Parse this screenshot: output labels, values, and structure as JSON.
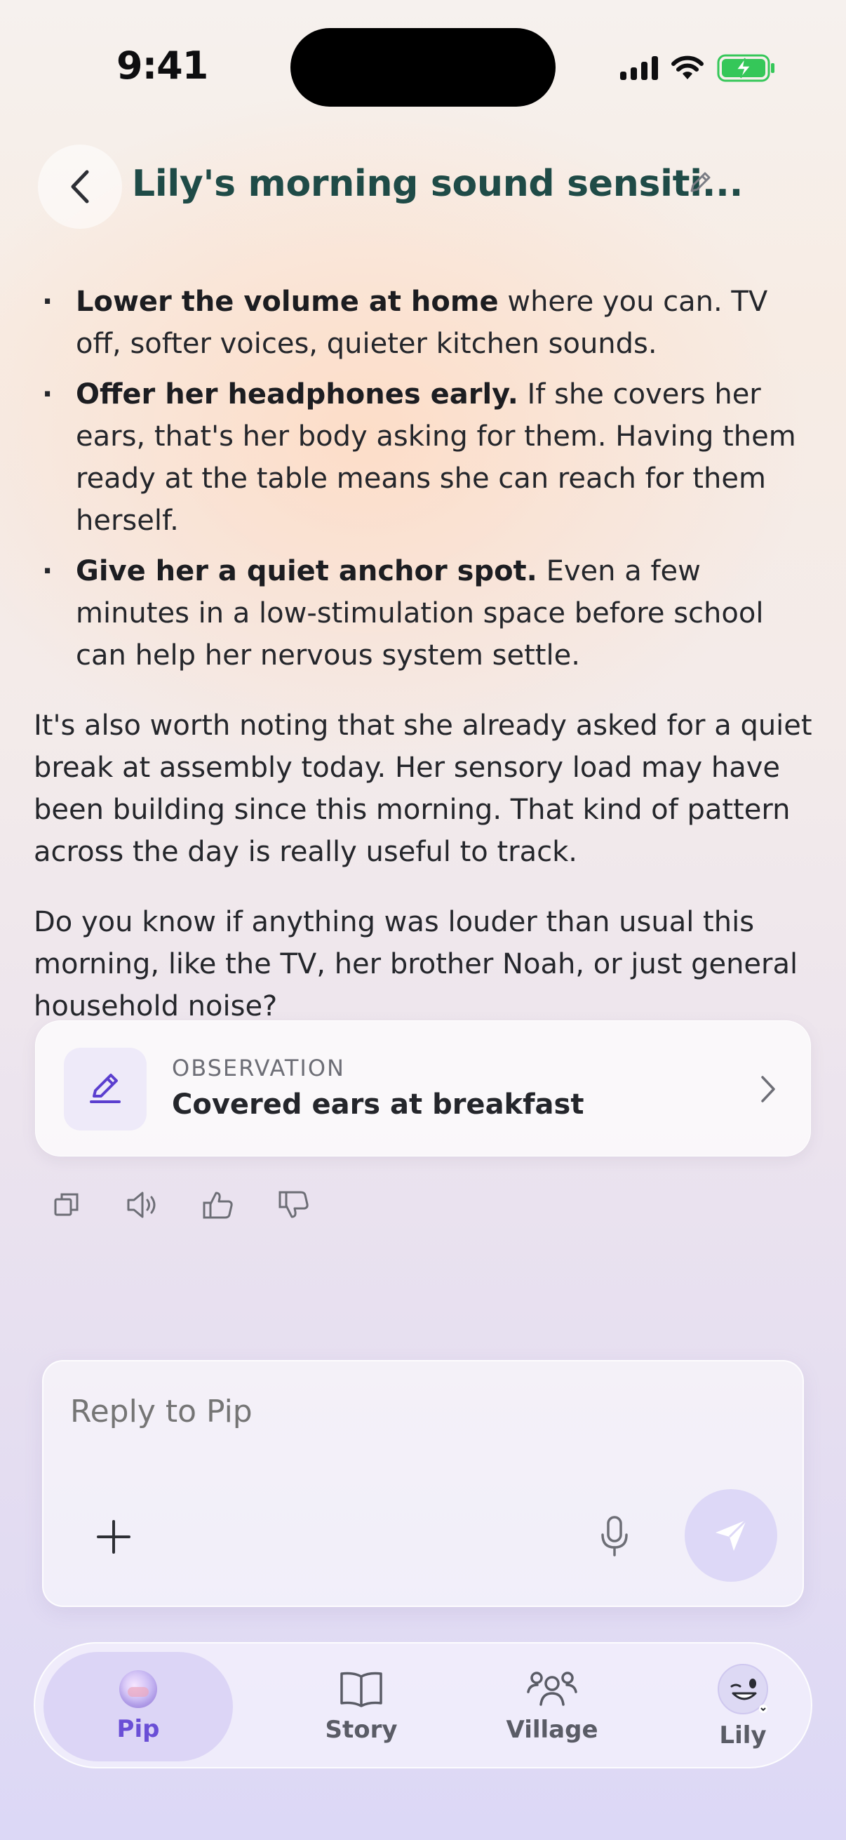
{
  "status_bar": {
    "time": "9:41"
  },
  "header": {
    "title": "Lily's morning sound sensiti..."
  },
  "message": {
    "bullets": [
      {
        "bold": "Lower the volume at home",
        "text": " where you can. TV off, softer voices, quieter kitchen sounds."
      },
      {
        "bold": "Offer her headphones early.",
        "text": " If she covers her ears, that's her body asking for them. Having them ready at the table means she can reach for them herself."
      },
      {
        "bold": "Give her a quiet anchor spot.",
        "text": " Even a few minutes in a low-stimulation space before school can help her nervous system settle."
      }
    ],
    "paragraph_1": "It's also worth noting that she already asked for a quiet break at assembly today. Her sensory load may have been building since this morning. That kind of pattern across the day is really useful to track.",
    "paragraph_2": "Do you know if anything was louder than usual this morning, like the TV, her brother Noah, or just general household noise?"
  },
  "observation_card": {
    "kind": "OBSERVATION",
    "title": "Covered ears at breakfast",
    "icon": "pencil-icon"
  },
  "composer": {
    "placeholder": "Reply to Pip"
  },
  "tabs": [
    {
      "label": "Pip",
      "icon": "pip-orb-icon",
      "active": true
    },
    {
      "label": "Story",
      "icon": "book-icon",
      "active": false
    },
    {
      "label": "Village",
      "icon": "people-icon",
      "active": false
    },
    {
      "label": "Lily",
      "icon": "avatar",
      "active": false
    }
  ],
  "colors": {
    "accent": "#6a4fd6",
    "title": "#1f4b47",
    "battery": "#35c759"
  }
}
